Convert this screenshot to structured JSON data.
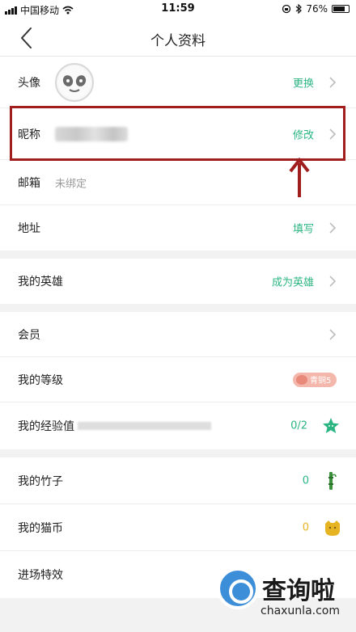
{
  "status_bar": {
    "carrier": "中国移动",
    "time": "11:59",
    "battery": "76%"
  },
  "nav": {
    "title": "个人资料"
  },
  "profile": {
    "avatar": {
      "label": "头像",
      "action": "更换"
    },
    "nickname": {
      "label": "昵称",
      "action": "修改"
    },
    "email": {
      "label": "邮箱",
      "value": "未绑定"
    },
    "address": {
      "label": "地址",
      "action": "填写"
    }
  },
  "hero": {
    "label": "我的英雄",
    "action": "成为英雄"
  },
  "membership": {
    "member_label": "会员",
    "level_label": "我的等级",
    "level_badge": "青铜5",
    "exp_label": "我的经验值",
    "exp_value": "0/2"
  },
  "assets": {
    "bamboo_label": "我的竹子",
    "bamboo_value": "0",
    "coin_label": "我的猫币",
    "coin_value": "0",
    "effect_label": "进场特效"
  },
  "watermark": {
    "brand": "查询啦",
    "url": "chaxunla.com"
  },
  "colors": {
    "accent_green": "#2bb583",
    "highlight_red": "#a01e1e",
    "coin_yellow": "#e6b422"
  },
  "icons": {
    "back": "chevron-left-icon",
    "chevron": "chevron-right-icon",
    "star": "star-icon",
    "bamboo": "bamboo-icon",
    "coin": "coin-icon"
  }
}
